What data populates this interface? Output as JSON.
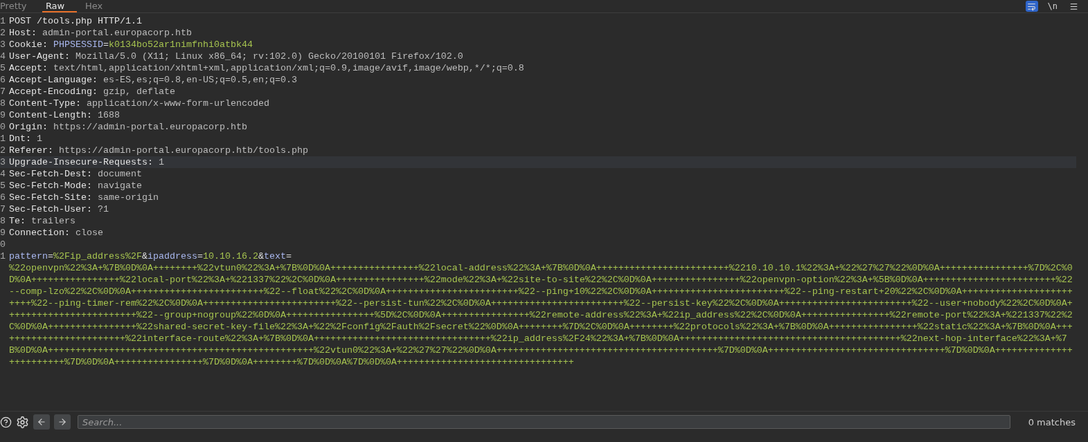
{
  "tabs": [
    {
      "label": "Pretty",
      "selected": false
    },
    {
      "label": "Raw",
      "selected": true
    },
    {
      "label": "Hex",
      "selected": false
    }
  ],
  "toolbar": {
    "wrap_selected": true,
    "newline_label": "\\n"
  },
  "lines": [
    {
      "number": "1",
      "current": false,
      "segments": [
        {
          "kind": "plain",
          "text": "POST /tools.php HTTP/1.1"
        }
      ]
    },
    {
      "number": "2",
      "current": false,
      "segments": [
        {
          "kind": "name",
          "text": "Host:"
        },
        {
          "kind": "value",
          "text": " admin-portal.europacorp.htb"
        }
      ]
    },
    {
      "number": "3",
      "current": false,
      "segments": [
        {
          "kind": "name",
          "text": "Cookie: "
        },
        {
          "kind": "key",
          "text": "PHPSESSID"
        },
        {
          "kind": "punct",
          "text": "="
        },
        {
          "kind": "green",
          "text": "k0134bo52ar1nimfnhi0atbk44"
        }
      ]
    },
    {
      "number": "4",
      "current": false,
      "segments": [
        {
          "kind": "name",
          "text": "User-Agent:"
        },
        {
          "kind": "value",
          "text": " Mozilla/5.0 (X11; Linux x86_64; rv:102.0) Gecko/20100101 Firefox/102.0"
        }
      ]
    },
    {
      "number": "5",
      "current": false,
      "segments": [
        {
          "kind": "name",
          "text": "Accept:"
        },
        {
          "kind": "value",
          "text": " text/html,application/xhtml+xml,application/xml;q=0.9,image/avif,image/webp,*/*;q=0.8"
        }
      ]
    },
    {
      "number": "6",
      "current": false,
      "segments": [
        {
          "kind": "name",
          "text": "Accept-Language:"
        },
        {
          "kind": "value",
          "text": " es-ES,es;q=0.8,en-US;q=0.5,en;q=0.3"
        }
      ]
    },
    {
      "number": "7",
      "current": false,
      "segments": [
        {
          "kind": "name",
          "text": "Accept-Encoding:"
        },
        {
          "kind": "value",
          "text": " gzip, deflate"
        }
      ]
    },
    {
      "number": "8",
      "current": false,
      "segments": [
        {
          "kind": "name",
          "text": "Content-Type:"
        },
        {
          "kind": "value",
          "text": " application/x-www-form-urlencoded"
        }
      ]
    },
    {
      "number": "9",
      "current": false,
      "segments": [
        {
          "kind": "name",
          "text": "Content-Length:"
        },
        {
          "kind": "value",
          "text": " 1688"
        }
      ]
    },
    {
      "number": "0",
      "current": false,
      "segments": [
        {
          "kind": "name",
          "text": "Origin:"
        },
        {
          "kind": "value",
          "text": " https://admin-portal.europacorp.htb"
        }
      ]
    },
    {
      "number": "1",
      "current": false,
      "segments": [
        {
          "kind": "name",
          "text": "Dnt:"
        },
        {
          "kind": "value",
          "text": " 1"
        }
      ]
    },
    {
      "number": "2",
      "current": false,
      "segments": [
        {
          "kind": "name",
          "text": "Referer:"
        },
        {
          "kind": "value",
          "text": " https://admin-portal.europacorp.htb/tools.php"
        }
      ]
    },
    {
      "number": "3",
      "current": true,
      "segments": [
        {
          "kind": "name",
          "text": "Upgrade-Insecure-Requests:"
        },
        {
          "kind": "value",
          "text": " 1"
        }
      ]
    },
    {
      "number": "4",
      "current": false,
      "segments": [
        {
          "kind": "name",
          "text": "Sec-Fetch-Dest:"
        },
        {
          "kind": "value",
          "text": " document"
        }
      ]
    },
    {
      "number": "5",
      "current": false,
      "segments": [
        {
          "kind": "name",
          "text": "Sec-Fetch-Mode:"
        },
        {
          "kind": "value",
          "text": " navigate"
        }
      ]
    },
    {
      "number": "6",
      "current": false,
      "segments": [
        {
          "kind": "name",
          "text": "Sec-Fetch-Site:"
        },
        {
          "kind": "value",
          "text": " same-origin"
        }
      ]
    },
    {
      "number": "7",
      "current": false,
      "segments": [
        {
          "kind": "name",
          "text": "Sec-Fetch-User:"
        },
        {
          "kind": "value",
          "text": " ?1"
        }
      ]
    },
    {
      "number": "8",
      "current": false,
      "segments": [
        {
          "kind": "name",
          "text": "Te:"
        },
        {
          "kind": "value",
          "text": " trailers"
        }
      ]
    },
    {
      "number": "9",
      "current": false,
      "segments": [
        {
          "kind": "name",
          "text": "Connection:"
        },
        {
          "kind": "value",
          "text": " close"
        }
      ]
    },
    {
      "number": "0",
      "current": false
    },
    {
      "number": "1",
      "current": false,
      "segments": [
        {
          "kind": "key",
          "text": "pattern"
        },
        {
          "kind": "punct",
          "text": "="
        },
        {
          "kind": "green",
          "text": "%2Fip_address%2F"
        },
        {
          "kind": "punct",
          "text": "&"
        },
        {
          "kind": "key",
          "text": "ipaddress"
        },
        {
          "kind": "punct",
          "text": "="
        },
        {
          "kind": "green",
          "text": "10.10.16.2"
        },
        {
          "kind": "punct",
          "text": "&"
        },
        {
          "kind": "key",
          "text": "text"
        },
        {
          "kind": "punct",
          "text": "="
        }
      ],
      "body": "%22openvpn%22%3A+%7B%0D%0A++++++++%22vtun0%22%3A+%7B%0D%0A++++++++++++++++%22local-address%22%3A+%7B%0D%0A++++++++++++++++++++++++%2210.10.10.1%22%3A+%22%27%27%22%0D%0A++++++++++++++++%7D%2C%0D%0A++++++++++++++++%22local-port%22%3A+%221337%22%2C%0D%0A++++++++++++++++%22mode%22%3A+%22site-to-site%22%2C%0D%0A++++++++++++++++%22openvpn-option%22%3A+%5B%0D%0A++++++++++++++++++++++++%22--comp-lzo%22%2C%0D%0A++++++++++++++++++++++++%22--float%22%2C%0D%0A++++++++++++++++++++++++%22--ping+10%22%2C%0D%0A++++++++++++++++++++++++%22--ping-restart+20%22%2C%0D%0A++++++++++++++++++++++++%22--ping-timer-rem%22%2C%0D%0A++++++++++++++++++++++++%22--persist-tun%22%2C%0D%0A++++++++++++++++++++++++%22--persist-key%22%2C%0D%0A++++++++++++++++++++++++%22--user+nobody%22%2C%0D%0A++++++++++++++++++++++++%22--group+nogroup%22%0D%0A++++++++++++++++%5D%2C%0D%0A++++++++++++++++%22remote-address%22%3A+%22ip_address%22%2C%0D%0A++++++++++++++++%22remote-port%22%3A+%221337%22%2C%0D%0A++++++++++++++++%22shared-secret-key-file%22%3A+%22%2Fconfig%2Fauth%2Fsecret%22%0D%0A++++++++%7D%2C%0D%0A++++++++%22protocols%22%3A+%7B%0D%0A++++++++++++++++%22static%22%3A+%7B%0D%0A++++++++++++++++++++++++%22interface-route%22%3A+%7B%0D%0A++++++++++++++++++++++++++++++++%22ip_address%2F24%22%3A+%7B%0D%0A++++++++++++++++++++++++++++++++++++++++%22next-hop-interface%22%3A+%7B%0D%0A++++++++++++++++++++++++++++++++++++++++++++++++%22vtun0%22%3A+%22%27%27%22%0D%0A++++++++++++++++++++++++++++++++++++++++%7D%0D%0A++++++++++++++++++++++++++++++++%7D%0D%0A++++++++++++++++++++++++%7D%0D%0A++++++++++++++++%7D%0D%0A++++++++%7D%0D%0A%7D%0D%0A++++++++++++++++++++++++++++++++"
    }
  ],
  "search": {
    "placeholder": "Search...",
    "matches": "0 matches"
  }
}
